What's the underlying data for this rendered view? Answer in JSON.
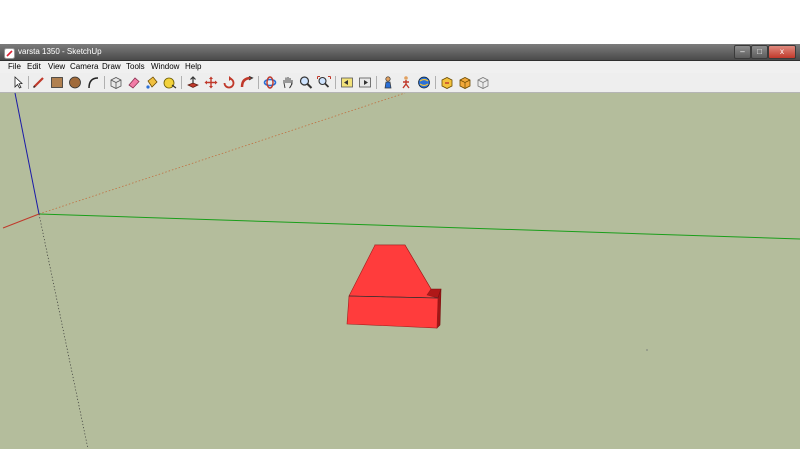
{
  "window": {
    "title": "varsta 1350 - SketchUp",
    "minimize_glyph": "–",
    "maximize_glyph": "□",
    "close_glyph": "x"
  },
  "menu": [
    "File",
    "Edit",
    "View",
    "Camera",
    "Draw",
    "Tools",
    "Window",
    "Help"
  ],
  "toolbar": {
    "tools": [
      "select-icon",
      "pencil-icon",
      "rectangle-icon",
      "circle-icon",
      "arc-icon",
      "make-component-icon",
      "eraser-icon",
      "paint-bucket-icon",
      "tape-measure-icon",
      "push-pull-icon",
      "move-icon",
      "rotate-icon",
      "follow-me-icon",
      "orbit-icon",
      "pan-icon",
      "zoom-icon",
      "zoom-extents-icon",
      "previous-view-icon",
      "next-view-icon",
      "position-camera-icon",
      "walk-icon",
      "get-models-icon",
      "share-model-icon",
      "share-component-icon"
    ]
  },
  "colors": {
    "viewport_background": "#b4bd9c",
    "model_face": "#ff3c3c",
    "model_dark": "#c81e1e",
    "axis_red": "#c0392b",
    "axis_green": "#1a9e1a",
    "axis_blue": "#1a1aa8"
  }
}
